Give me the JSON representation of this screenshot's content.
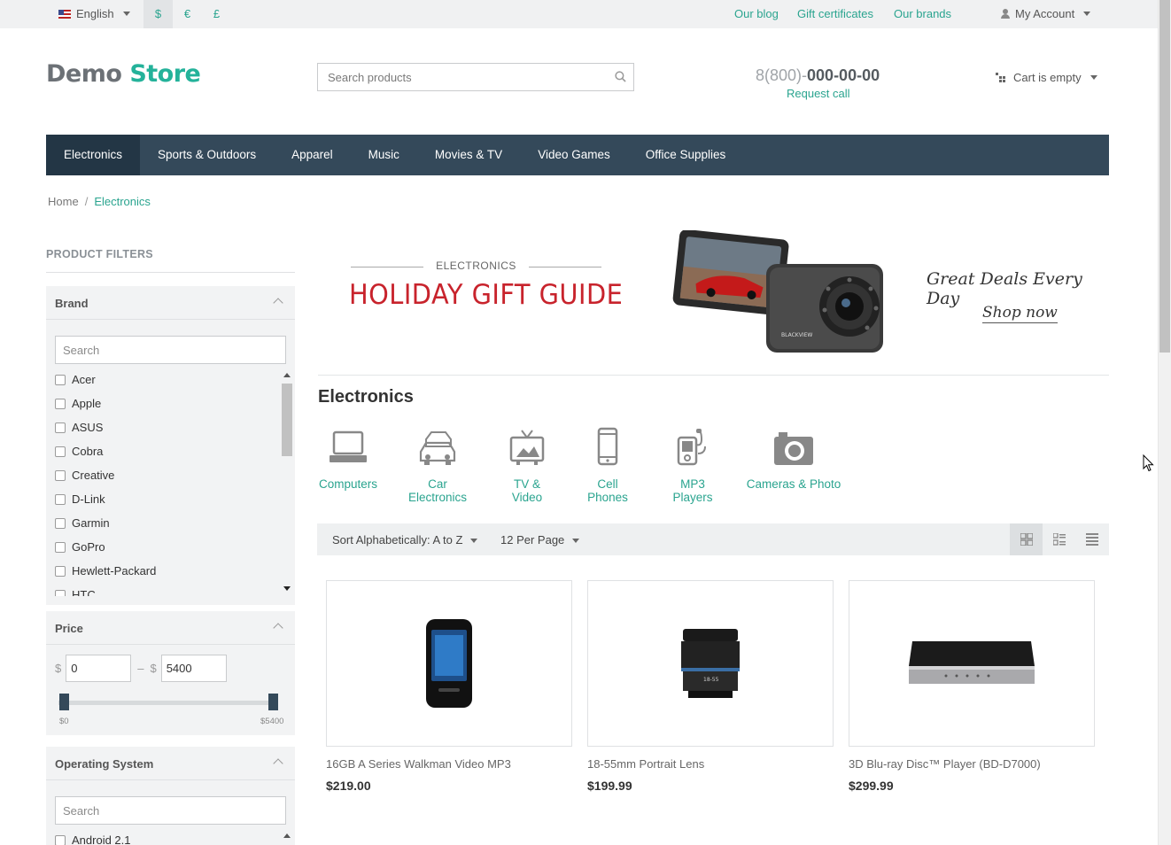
{
  "topbar": {
    "language": "English",
    "currencies": [
      "$",
      "€",
      "£"
    ],
    "links": [
      "Our blog",
      "Gift certificates",
      "Our brands"
    ],
    "account": "My Account"
  },
  "header": {
    "logo_part1": "Demo",
    "logo_part2": "Store",
    "search_placeholder": "Search products",
    "phone_code": "8(800)-",
    "phone_number": "000-00-00",
    "request_call": "Request call",
    "cart": "Cart is empty"
  },
  "menu": [
    "Electronics",
    "Sports & Outdoors",
    "Apparel",
    "Music",
    "Movies & TV",
    "Video Games",
    "Office Supplies"
  ],
  "breadcrumb": {
    "home": "Home",
    "current": "Electronics"
  },
  "filters": {
    "title": "PRODUCT FILTERS",
    "brand": {
      "label": "Brand",
      "search_placeholder": "Search",
      "items": [
        "Acer",
        "Apple",
        "ASUS",
        "Cobra",
        "Creative",
        "D-Link",
        "Garmin",
        "GoPro",
        "Hewlett-Packard",
        "HTC"
      ]
    },
    "price": {
      "label": "Price",
      "currency": "$",
      "dash": "–",
      "min_value": "0",
      "max_value": "5400",
      "min_label": "$0",
      "max_label": "$5400"
    },
    "os": {
      "label": "Operating System",
      "search_placeholder": "Search",
      "items": [
        "Android 2.1"
      ]
    }
  },
  "banner": {
    "kicker": "ELECTRONICS",
    "headline": "HOLIDAY GIFT GUIDE",
    "camera_brand": "BLACKVIEW",
    "tagline": "Great Deals Every Day",
    "cta": "Shop now"
  },
  "category": {
    "title": "Electronics",
    "subcategories": [
      "Computers",
      "Car Electronics",
      "TV & Video",
      "Cell Phones",
      "MP3 Players",
      "Cameras & Photo"
    ]
  },
  "toolbar": {
    "sort": "Sort Alphabetically: A to Z",
    "per_page": "12 Per Page"
  },
  "products": [
    {
      "name": "16GB A Series Walkman Video MP3",
      "price": "$219.00"
    },
    {
      "name": "18-55mm Portrait Lens",
      "price": "$199.99"
    },
    {
      "name": "3D Blu-ray Disc™ Player (BD-D7000)",
      "price": "$299.99"
    }
  ],
  "colors": {
    "accent": "#2aa48f",
    "menu": "#34495a",
    "menu_active": "#233645",
    "banner_red": "#c8232c"
  },
  "icons": [
    "search-icon",
    "user-icon",
    "cart-icon",
    "grid-view-icon",
    "list-view-icon",
    "compact-list-icon",
    "chevron-up-icon"
  ]
}
